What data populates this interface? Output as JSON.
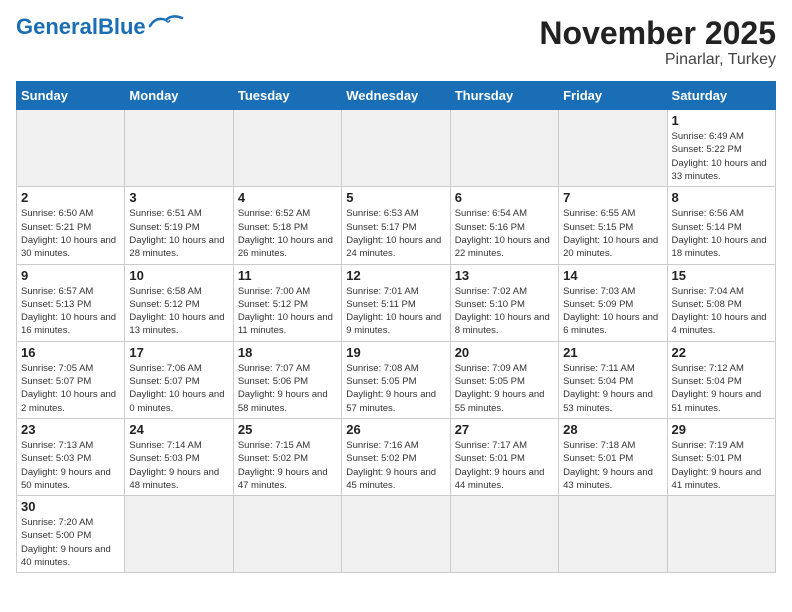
{
  "header": {
    "logo_general": "General",
    "logo_blue": "Blue",
    "title": "November 2025",
    "subtitle": "Pinarlar, Turkey"
  },
  "weekdays": [
    "Sunday",
    "Monday",
    "Tuesday",
    "Wednesday",
    "Thursday",
    "Friday",
    "Saturday"
  ],
  "days": [
    {
      "num": "",
      "info": "",
      "empty": true
    },
    {
      "num": "",
      "info": "",
      "empty": true
    },
    {
      "num": "",
      "info": "",
      "empty": true
    },
    {
      "num": "",
      "info": "",
      "empty": true
    },
    {
      "num": "",
      "info": "",
      "empty": true
    },
    {
      "num": "",
      "info": "",
      "empty": true
    },
    {
      "num": "1",
      "info": "Sunrise: 6:49 AM\nSunset: 5:22 PM\nDaylight: 10 hours\nand 33 minutes."
    },
    {
      "num": "2",
      "info": "Sunrise: 6:50 AM\nSunset: 5:21 PM\nDaylight: 10 hours\nand 30 minutes."
    },
    {
      "num": "3",
      "info": "Sunrise: 6:51 AM\nSunset: 5:19 PM\nDaylight: 10 hours\nand 28 minutes."
    },
    {
      "num": "4",
      "info": "Sunrise: 6:52 AM\nSunset: 5:18 PM\nDaylight: 10 hours\nand 26 minutes."
    },
    {
      "num": "5",
      "info": "Sunrise: 6:53 AM\nSunset: 5:17 PM\nDaylight: 10 hours\nand 24 minutes."
    },
    {
      "num": "6",
      "info": "Sunrise: 6:54 AM\nSunset: 5:16 PM\nDaylight: 10 hours\nand 22 minutes."
    },
    {
      "num": "7",
      "info": "Sunrise: 6:55 AM\nSunset: 5:15 PM\nDaylight: 10 hours\nand 20 minutes."
    },
    {
      "num": "8",
      "info": "Sunrise: 6:56 AM\nSunset: 5:14 PM\nDaylight: 10 hours\nand 18 minutes."
    },
    {
      "num": "9",
      "info": "Sunrise: 6:57 AM\nSunset: 5:13 PM\nDaylight: 10 hours\nand 16 minutes."
    },
    {
      "num": "10",
      "info": "Sunrise: 6:58 AM\nSunset: 5:12 PM\nDaylight: 10 hours\nand 13 minutes."
    },
    {
      "num": "11",
      "info": "Sunrise: 7:00 AM\nSunset: 5:12 PM\nDaylight: 10 hours\nand 11 minutes."
    },
    {
      "num": "12",
      "info": "Sunrise: 7:01 AM\nSunset: 5:11 PM\nDaylight: 10 hours\nand 9 minutes."
    },
    {
      "num": "13",
      "info": "Sunrise: 7:02 AM\nSunset: 5:10 PM\nDaylight: 10 hours\nand 8 minutes."
    },
    {
      "num": "14",
      "info": "Sunrise: 7:03 AM\nSunset: 5:09 PM\nDaylight: 10 hours\nand 6 minutes."
    },
    {
      "num": "15",
      "info": "Sunrise: 7:04 AM\nSunset: 5:08 PM\nDaylight: 10 hours\nand 4 minutes."
    },
    {
      "num": "16",
      "info": "Sunrise: 7:05 AM\nSunset: 5:07 PM\nDaylight: 10 hours\nand 2 minutes."
    },
    {
      "num": "17",
      "info": "Sunrise: 7:06 AM\nSunset: 5:07 PM\nDaylight: 10 hours\nand 0 minutes."
    },
    {
      "num": "18",
      "info": "Sunrise: 7:07 AM\nSunset: 5:06 PM\nDaylight: 9 hours\nand 58 minutes."
    },
    {
      "num": "19",
      "info": "Sunrise: 7:08 AM\nSunset: 5:05 PM\nDaylight: 9 hours\nand 57 minutes."
    },
    {
      "num": "20",
      "info": "Sunrise: 7:09 AM\nSunset: 5:05 PM\nDaylight: 9 hours\nand 55 minutes."
    },
    {
      "num": "21",
      "info": "Sunrise: 7:11 AM\nSunset: 5:04 PM\nDaylight: 9 hours\nand 53 minutes."
    },
    {
      "num": "22",
      "info": "Sunrise: 7:12 AM\nSunset: 5:04 PM\nDaylight: 9 hours\nand 51 minutes."
    },
    {
      "num": "23",
      "info": "Sunrise: 7:13 AM\nSunset: 5:03 PM\nDaylight: 9 hours\nand 50 minutes."
    },
    {
      "num": "24",
      "info": "Sunrise: 7:14 AM\nSunset: 5:03 PM\nDaylight: 9 hours\nand 48 minutes."
    },
    {
      "num": "25",
      "info": "Sunrise: 7:15 AM\nSunset: 5:02 PM\nDaylight: 9 hours\nand 47 minutes."
    },
    {
      "num": "26",
      "info": "Sunrise: 7:16 AM\nSunset: 5:02 PM\nDaylight: 9 hours\nand 45 minutes."
    },
    {
      "num": "27",
      "info": "Sunrise: 7:17 AM\nSunset: 5:01 PM\nDaylight: 9 hours\nand 44 minutes."
    },
    {
      "num": "28",
      "info": "Sunrise: 7:18 AM\nSunset: 5:01 PM\nDaylight: 9 hours\nand 43 minutes."
    },
    {
      "num": "29",
      "info": "Sunrise: 7:19 AM\nSunset: 5:01 PM\nDaylight: 9 hours\nand 41 minutes."
    },
    {
      "num": "30",
      "info": "Sunrise: 7:20 AM\nSunset: 5:00 PM\nDaylight: 9 hours\nand 40 minutes."
    },
    {
      "num": "",
      "info": "",
      "empty": true
    },
    {
      "num": "",
      "info": "",
      "empty": true
    },
    {
      "num": "",
      "info": "",
      "empty": true
    },
    {
      "num": "",
      "info": "",
      "empty": true
    },
    {
      "num": "",
      "info": "",
      "empty": true
    },
    {
      "num": "",
      "info": "",
      "empty": true
    }
  ]
}
